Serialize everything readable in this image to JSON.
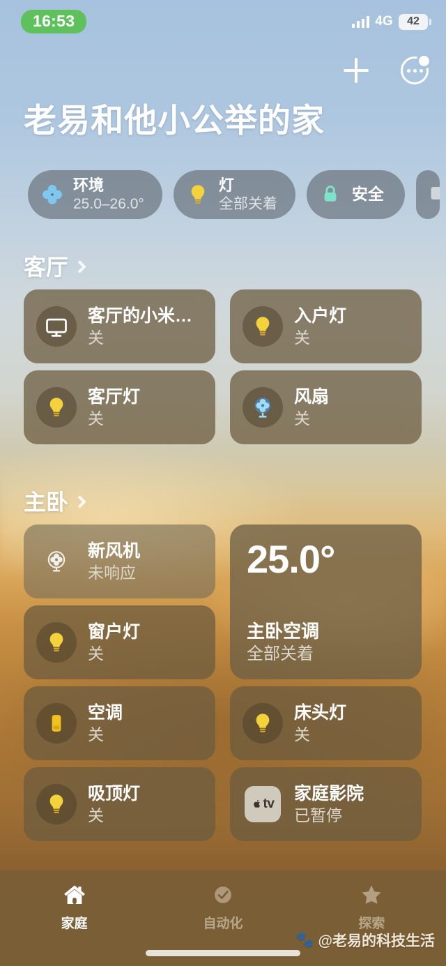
{
  "status_bar": {
    "time": "16:53",
    "time_pill_color": "#5fc15c",
    "network": "4G",
    "battery": "42",
    "signal_icon": "cellular-bars-icon",
    "battery_icon": "battery-icon"
  },
  "nav": {
    "add_icon": "plus-icon",
    "more_icon": "ellipsis-circle-icon"
  },
  "header": {
    "home_name": "老易和他小公举的家"
  },
  "status_pills": [
    {
      "icon": "fan-icon",
      "icon_color": "#7ec8f0",
      "title": "环境",
      "subtitle": "25.0–26.0°"
    },
    {
      "icon": "lightbulb-icon",
      "icon_color": "#f4d23c",
      "title": "灯",
      "subtitle": "全部关着"
    },
    {
      "icon": "lock-icon",
      "icon_color": "#7fe3cb",
      "title": "安全",
      "subtitle": ""
    },
    {
      "icon": "partial-pill-icon",
      "icon_color": "#cfd6dc",
      "title": "",
      "subtitle": ""
    }
  ],
  "sections": [
    {
      "name": "客厅",
      "chevron_icon": "chevron-right-icon",
      "tiles": [
        {
          "icon": "tv-icon",
          "name": "客厅的小米…",
          "state": "关"
        },
        {
          "icon": "lightbulb-icon",
          "name": "入户灯",
          "state": "关"
        },
        {
          "icon": "lightbulb-icon",
          "name": "客厅灯",
          "state": "关"
        },
        {
          "icon": "fan-icon",
          "name": "风扇",
          "state": "关"
        }
      ]
    },
    {
      "name": "主卧",
      "chevron_icon": "chevron-right-icon",
      "tiles": [
        {
          "icon": "air-purifier-icon",
          "name": "新风机",
          "state": "未响应"
        },
        {
          "icon": "lightbulb-icon",
          "name": "窗户灯",
          "state": "关"
        },
        {
          "icon": "air-conditioner-icon",
          "name": "空调",
          "state": "关"
        },
        {
          "icon": "lightbulb-icon",
          "name": "床头灯",
          "state": "关"
        },
        {
          "icon": "lightbulb-icon",
          "name": "吸顶灯",
          "state": "关"
        },
        {
          "icon": "apple-tv-icon",
          "name": "家庭影院",
          "state": "已暂停"
        }
      ],
      "climate_tile": {
        "temperature": "25.0°",
        "name": "主卧空调",
        "state": "全部关着"
      }
    }
  ],
  "tab_bar": [
    {
      "icon": "house-icon",
      "label": "家庭",
      "active": true
    },
    {
      "icon": "clock-check-icon",
      "label": "自动化",
      "active": false
    },
    {
      "icon": "star-icon",
      "label": "探索",
      "active": false
    }
  ],
  "watermark": {
    "logo": "paw-logo-icon",
    "text": "@老易的科技生活"
  }
}
